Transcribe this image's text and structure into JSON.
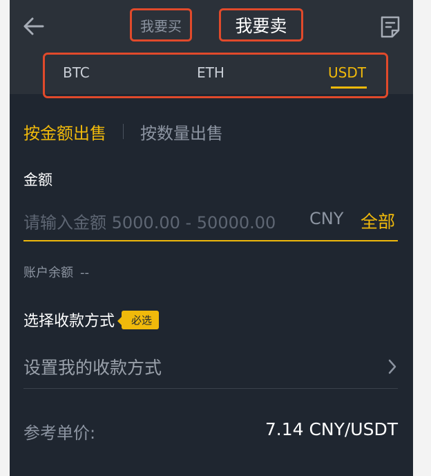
{
  "header": {
    "back_icon": "arrow-left-icon",
    "tab_buy_label": "我要买",
    "tab_sell_label": "我要卖",
    "orders_icon": "document-edit-icon"
  },
  "coins": {
    "items": [
      "BTC",
      "ETH",
      "USDT"
    ],
    "selected": "USDT"
  },
  "mode": {
    "by_amount": "按金额出售",
    "by_quantity": "按数量出售"
  },
  "amount": {
    "label": "金额",
    "placeholder": "请输入金额 5000.00 - 50000.00",
    "currency": "CNY",
    "all_label": "全部"
  },
  "balance": {
    "label": "账户余额",
    "value": "--"
  },
  "payment": {
    "title": "选择收款方式",
    "required_badge": "必选",
    "setup_label": "设置我的收款方式"
  },
  "reference": {
    "label": "参考单价:",
    "value": "7.14 CNY/USDT"
  },
  "colors": {
    "accent": "#f0b90b",
    "background": "#1f2630",
    "header_bg": "#2b3139",
    "highlight_box": "#e14a2b"
  }
}
